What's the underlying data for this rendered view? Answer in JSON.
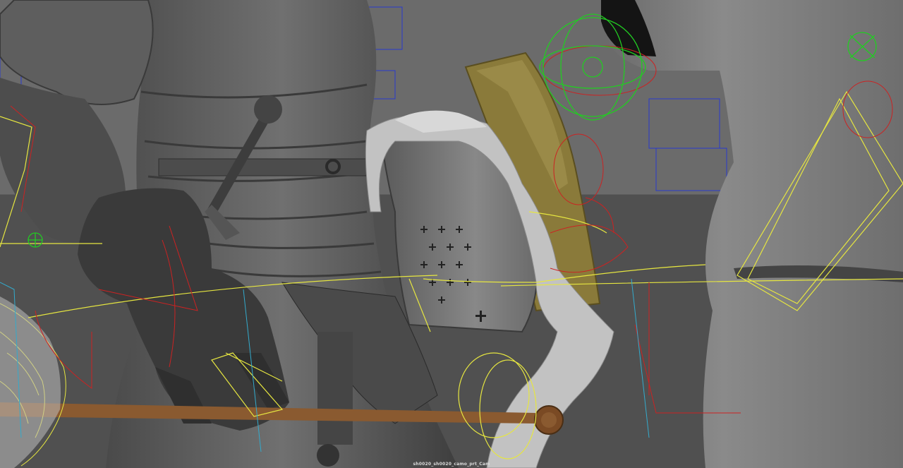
{
  "viewport": {
    "camera_label": "sh0020_sh0020_camo_prt_Cam"
  },
  "colors": {
    "background_upper": "#6b6b6b",
    "background_lower": "#505050",
    "armor_gray": "#555555",
    "gauntlet_dark": "#3a3a3a",
    "helmet_gray": "#7a7a7a",
    "mantling_light": "#c8c8c8",
    "shield_gold": "#8a7a3a",
    "shaft_brown": "#8a5a30",
    "wire_blue": "#2a3acc",
    "wire_green": "#22cc22",
    "wire_red": "#cc2222",
    "wire_yellow": "#e6e640",
    "wire_cyan": "#33aacc"
  }
}
